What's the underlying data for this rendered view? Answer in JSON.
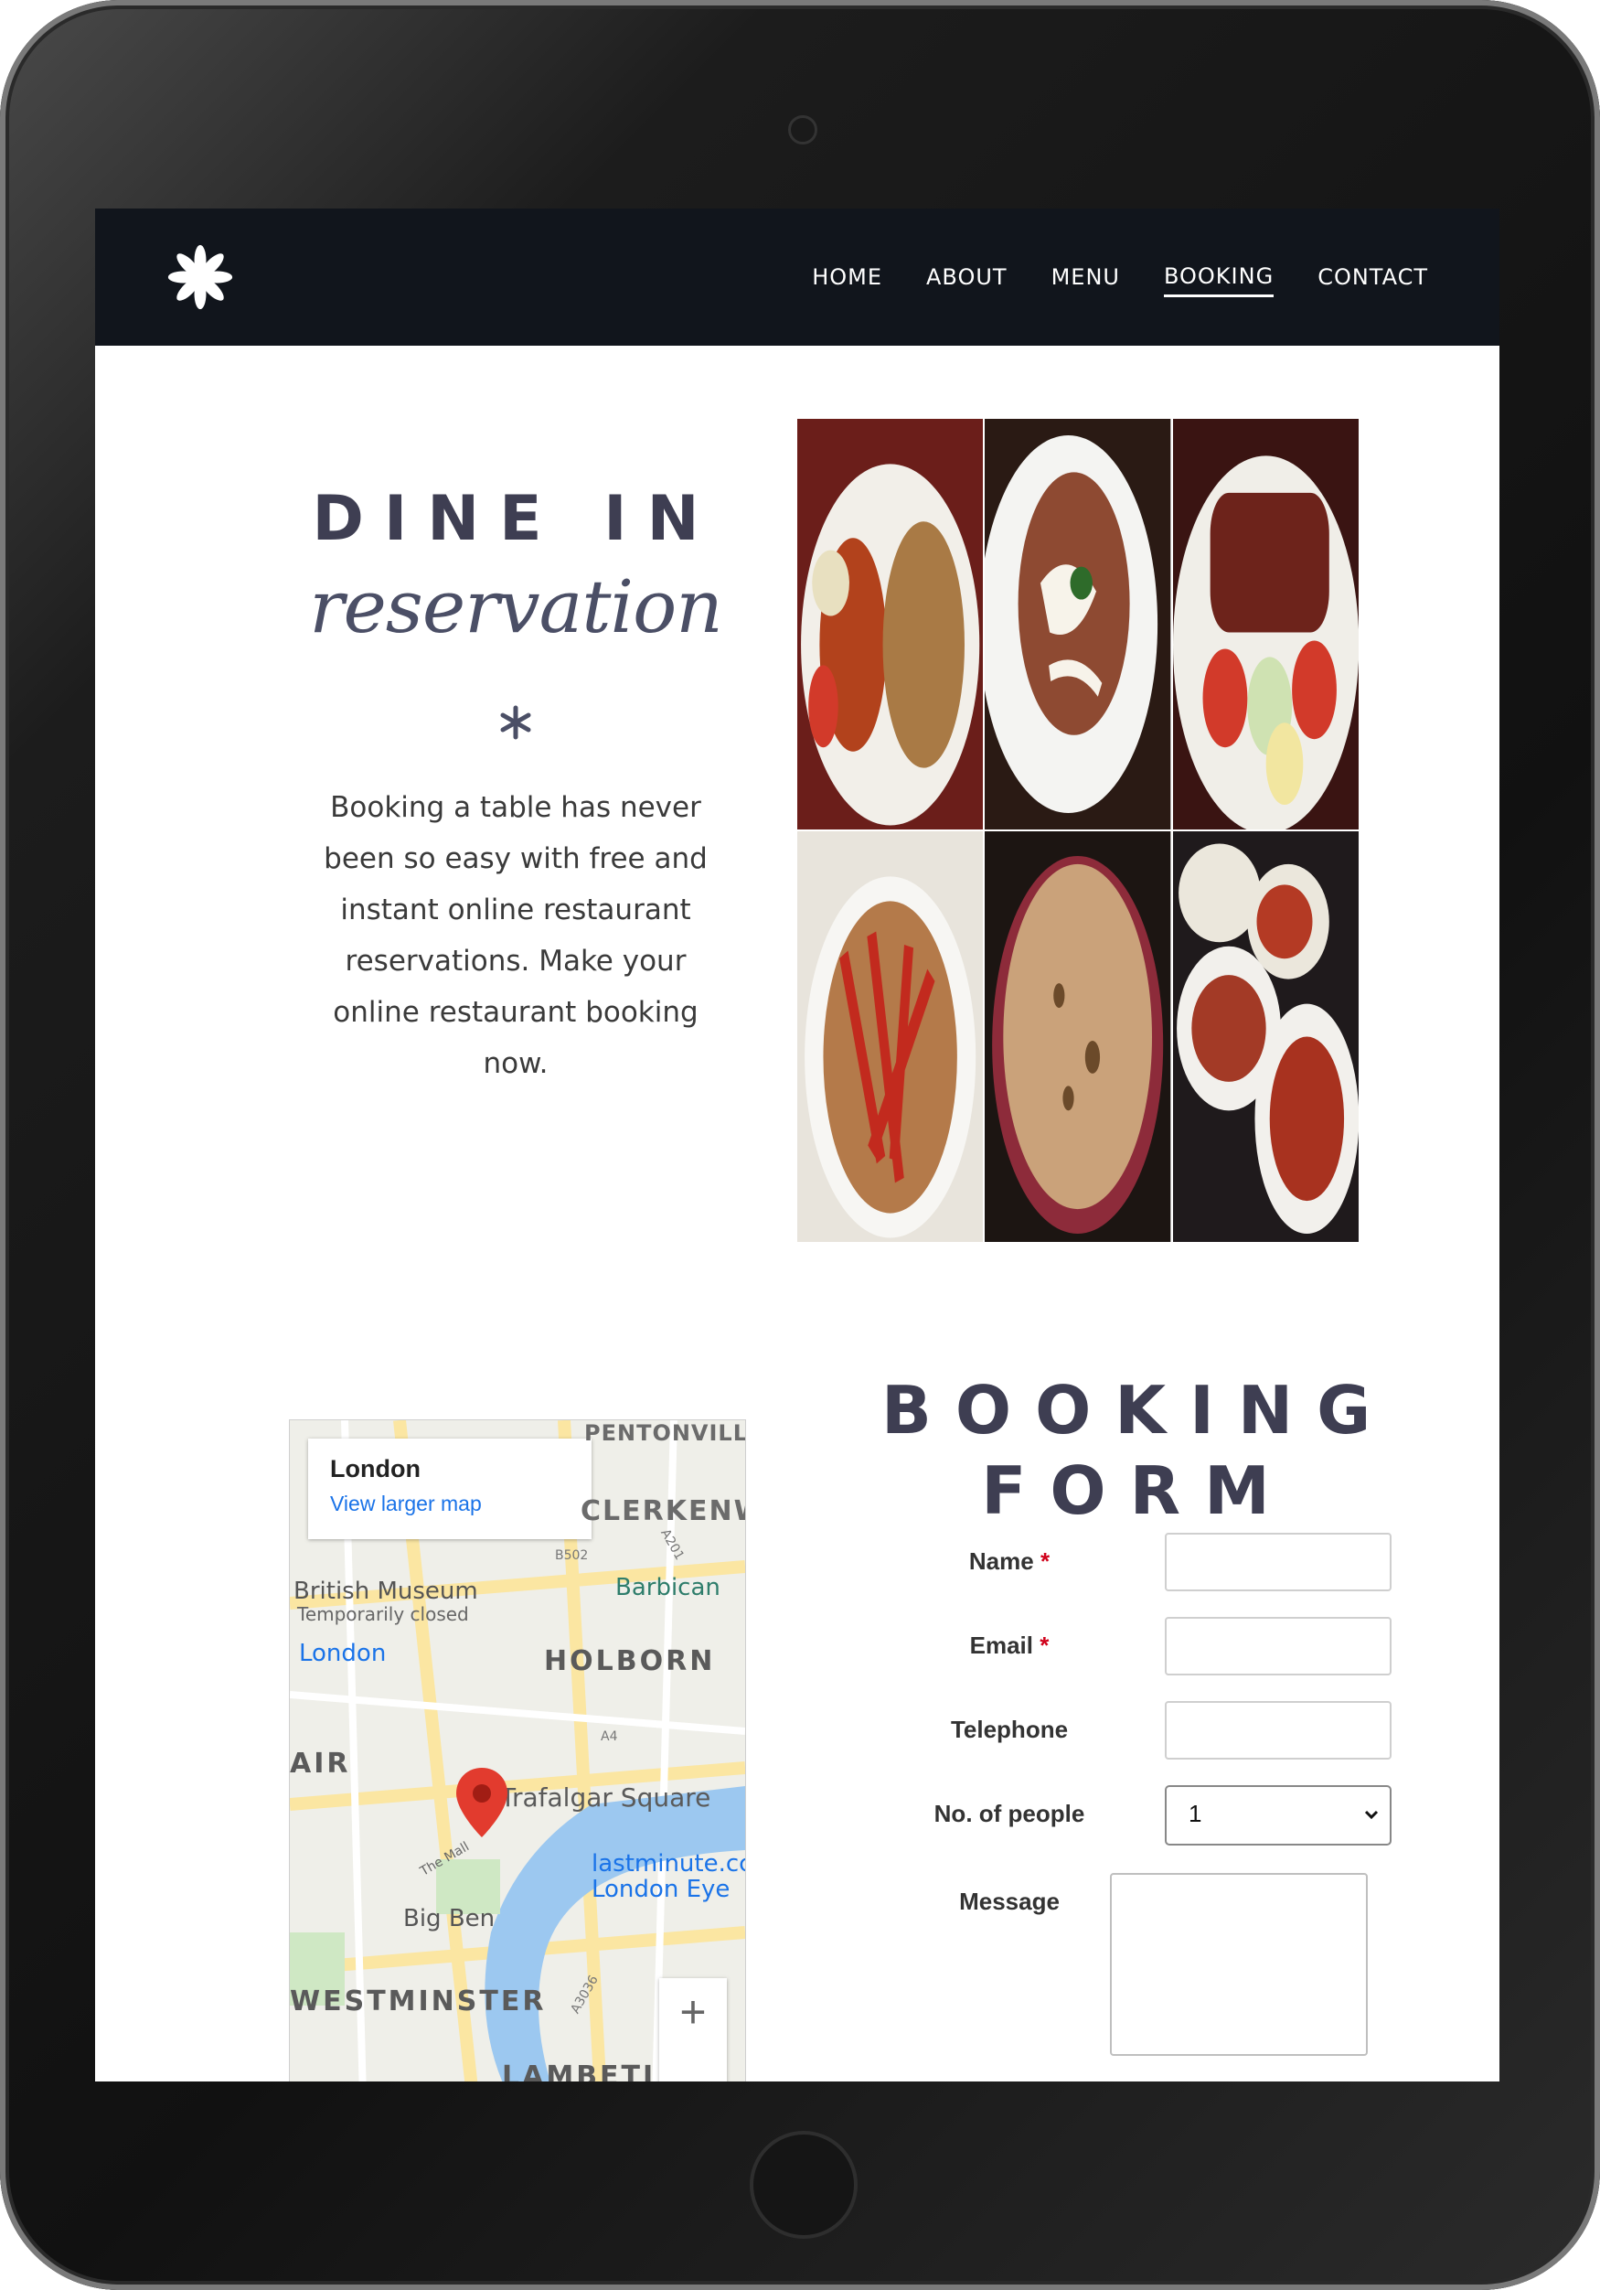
{
  "nav": {
    "items": [
      {
        "label": "HOME",
        "active": false
      },
      {
        "label": "ABOUT",
        "active": false
      },
      {
        "label": "MENU",
        "active": false
      },
      {
        "label": "BOOKING",
        "active": true
      },
      {
        "label": "CONTACT",
        "active": false
      }
    ]
  },
  "hero": {
    "title": "DINE IN",
    "script_title": "reservation",
    "description": "Booking a table has never been so easy with free and instant online restaurant reservations. Make your online restaurant booking now."
  },
  "map": {
    "place": "London",
    "link": "View larger map",
    "labels": [
      "PENTONVILLE",
      "CLERKENW",
      "British Museum",
      "Temporarily closed",
      "Barbican",
      "London",
      "HOLBORN",
      "AIR",
      "Trafalgar Square",
      "lastminute.cc",
      "London Eye",
      "Big Ben",
      "WESTMINSTER",
      "LAMBETI",
      "The Mall",
      "B502",
      "A201",
      "A4",
      "A3036"
    ],
    "zoom_in": "+",
    "zoom_out": "−"
  },
  "form": {
    "title_line1": "BOOKING",
    "title_line2": "FORM",
    "name_label": "Name",
    "email_label": "Email",
    "telephone_label": "Telephone",
    "people_label": "No. of people",
    "people_value": "1",
    "message_label": "Message",
    "required_mark": "*"
  },
  "colors": {
    "nav_bg": "#11151c",
    "heading": "#3e3e52",
    "required": "#d0021b",
    "map_link": "#1a73e8"
  }
}
